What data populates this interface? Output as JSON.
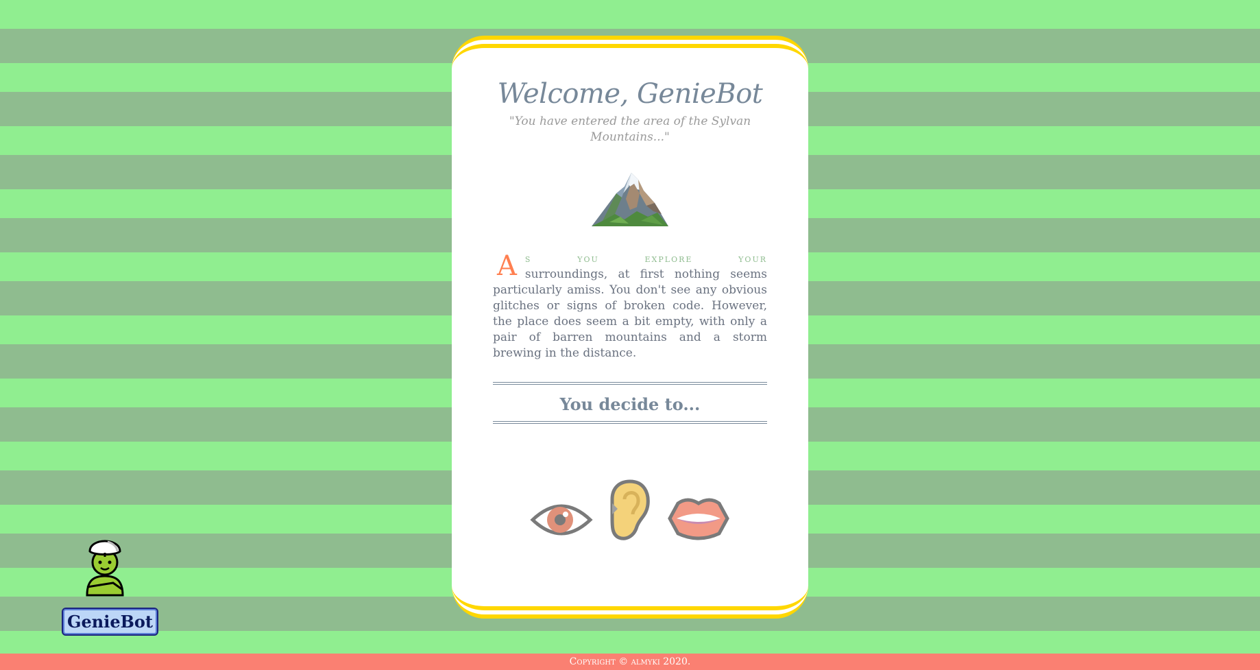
{
  "card": {
    "title": "Welcome, GenieBot",
    "subtitle": "\"You have entered the area of the Sylvan Mountains...\"",
    "scene_icon": "mountain-icon",
    "story": {
      "drop_cap": "A",
      "lead": "s you explore your",
      "body": "surroundings, at first nothing seems particularly amiss. You don't see any obvious glitches or signs of broken code. However, the place does seem a bit empty, with only a pair of barren mountains and a storm brewing in the distance."
    },
    "prompt": "You decide to...",
    "actions": [
      {
        "icon": "eye-icon"
      },
      {
        "icon": "ear-icon"
      },
      {
        "icon": "mouth-icon"
      }
    ]
  },
  "player": {
    "avatar_icon": "genie-icon",
    "name": "GenieBot"
  },
  "footer": {
    "text": "Copyright © almyki 2020."
  },
  "colors": {
    "stripe_light": "#90ee90",
    "stripe_dark": "#8fbc8f",
    "card_border": "#ffd700",
    "title": "#778899",
    "drop_cap": "#ff7f50",
    "footer": "#fa8072"
  }
}
